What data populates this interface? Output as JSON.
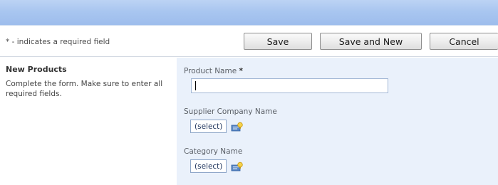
{
  "header": {
    "bar_color": "#a9c6f0"
  },
  "toolbar": {
    "required_note": "* - indicates a required field",
    "save_label": "Save",
    "save_and_new_label": "Save and New",
    "cancel_label": "Cancel"
  },
  "section": {
    "title": "New Products",
    "description": "Complete the form. Make sure to enter all required fields."
  },
  "form": {
    "product_name": {
      "label": "Product Name",
      "required_marker": "*",
      "value": ""
    },
    "supplier": {
      "label": "Supplier Company Name",
      "select_label": "(select)",
      "icon": "address-book-icon"
    },
    "category": {
      "label": "Category Name",
      "select_label": "(select)",
      "icon": "address-book-icon"
    }
  },
  "colors": {
    "form_background": "#eaf1fb",
    "header_bar": "#a9c6f0"
  }
}
